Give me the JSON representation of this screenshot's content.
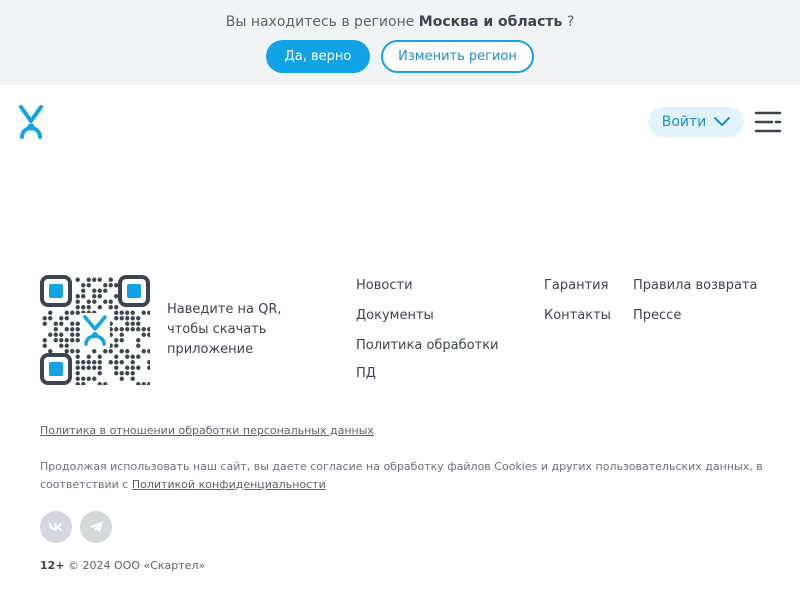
{
  "region_bar": {
    "prefix": "Вы находитесь в регионе",
    "region": "Москва и область",
    "suffix": "?",
    "confirm_label": "Да, верно",
    "change_label": "Изменить регион"
  },
  "header": {
    "logo_icon": "yota-logo-icon",
    "login_label": "Войти",
    "menu_icon": "menu-icon"
  },
  "footer": {
    "qr_caption": "Наведите на QR, чтобы скачать приложение",
    "links": {
      "news": "Новости",
      "documents": "Документы",
      "policy_processing": "Политика обработки",
      "pd": "ПД",
      "warranty": "Гарантия",
      "contacts": "Контакты",
      "return_rules": "Правила возврата",
      "press": "Прессе"
    },
    "personal_data_policy": "Политика в отношении обработки персональных данных",
    "cookie_text": "Продолжая использовать наш сайт, вы даете согласие на обработку файлов Cookies и других пользовательских данных, в соответствии с",
    "privacy_link": "Политикой конфиденциальности",
    "socials": [
      "vk-icon",
      "telegram-icon"
    ],
    "age_rating": "12+",
    "copyright": "© 2024 ООО «Скартел»"
  },
  "colors": {
    "accent": "#12a2e6",
    "region_bg": "#f2f3f5",
    "login_bg": "#e2f3fb",
    "text": "#3d4452",
    "social_bg": "#d5d8de"
  }
}
